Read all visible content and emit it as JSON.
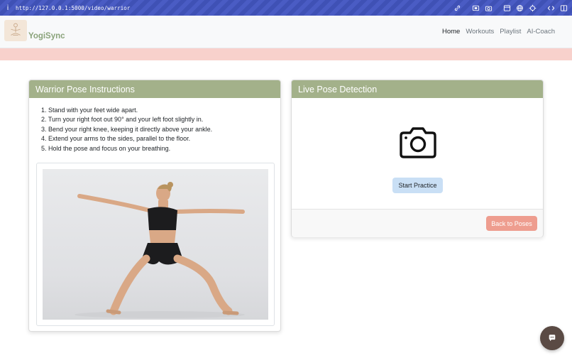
{
  "browser": {
    "url": "http://127.0.0.1:5000/video/warrior",
    "info_icon": "info-icon"
  },
  "navbar": {
    "brand": "YogiSync",
    "links": [
      {
        "label": "Home",
        "active": true
      },
      {
        "label": "Workouts",
        "active": false
      },
      {
        "label": "Playlist",
        "active": false
      },
      {
        "label": "AI-Coach",
        "active": false
      }
    ]
  },
  "instructions": {
    "title": "Warrior Pose Instructions",
    "steps": [
      "1. Stand with your feet wide apart.",
      "2. Turn your right foot out 90° and your left foot slightly in.",
      "3. Bend your right knee, keeping it directly above your ankle.",
      "4. Extend your arms to the sides, parallel to the floor.",
      "5. Hold the pose and focus on your breathing."
    ]
  },
  "detection": {
    "title": "Live Pose Detection",
    "start_label": "Start Practice",
    "back_label": "Back to Poses",
    "camera_icon": "camera-icon"
  },
  "colors": {
    "card_header": "#a3b18a",
    "pink_band": "#f8d1cc",
    "start_button": "#c9dff5",
    "back_button": "#ee9d8f",
    "chat_button": "#5a4a44"
  }
}
